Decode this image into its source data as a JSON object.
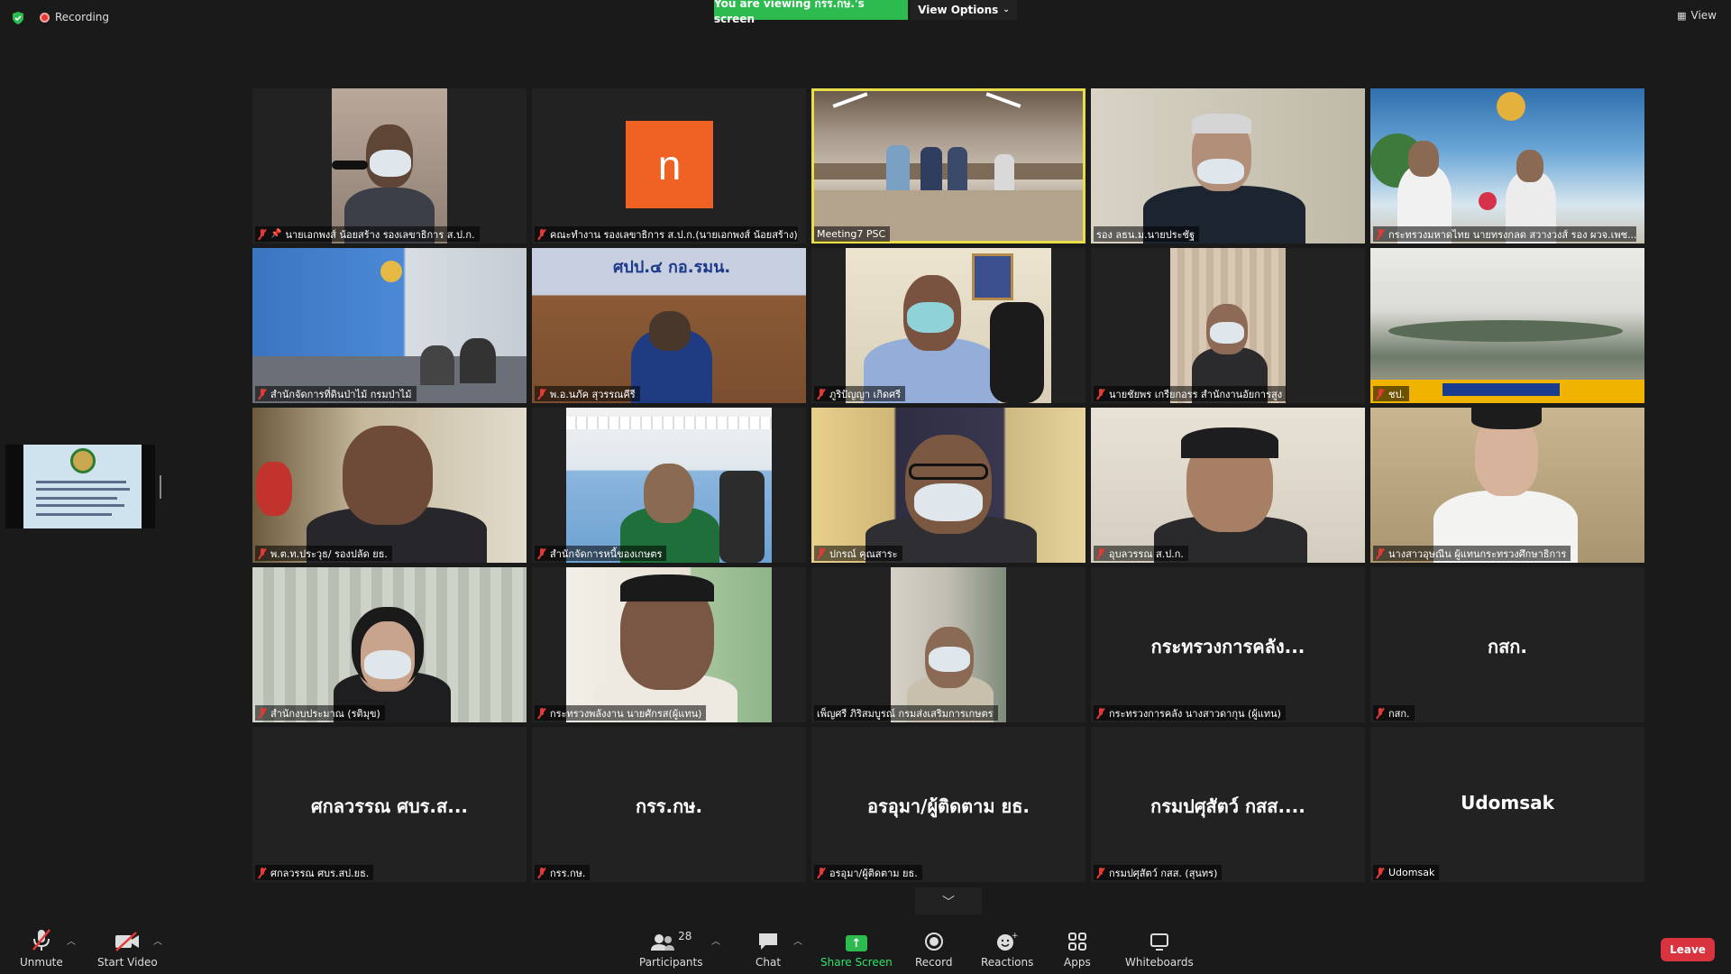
{
  "top_bar": {
    "recording_label": "Recording",
    "viewing_banner": "You are viewing กรร.กษ.'s screen",
    "view_options_label": "View Options",
    "view_label": "View"
  },
  "tiles": [
    {
      "name": "นายเอกพงส์ น้อยสร้าง รองเลขาธิการ ส.ป.ก.",
      "pinned": true
    },
    {
      "name": "คณะทำงาน รองเลขาธิการ ส.ป.ก.(นายเอกพงส์ น้อยสร้าง)",
      "avatar_letter": "n"
    },
    {
      "name": "Meeting7 PSC",
      "active": true
    },
    {
      "name": "รอง ลธน.ม.นายประชัฐ"
    },
    {
      "name": "กระทรวงมหาดไทย นายทรงกลด สวางวงส์ รอง ผวจ.เพช..."
    },
    {
      "name": "สำนักจัดการที่ดินป่าไม้ กรมป่าไม้"
    },
    {
      "name": "พ.อ.นภัค สุวรรณคีรี"
    },
    {
      "name": "ภูริปัญญา เกิดศรี"
    },
    {
      "name": "นายชัยพร เกรียกอรร สำนักงานอัยการสูง"
    },
    {
      "name": "ชป."
    },
    {
      "name": "พ.ต.ท.ประวุธ/ รองปลัด ยธ."
    },
    {
      "name": "สำนักจัดการหนี้ของเกษตร"
    },
    {
      "name": "ปกรณ์ คุณสาระ"
    },
    {
      "name": "อุบลวรรณ ส.ป.ก."
    },
    {
      "name": "นางสาวอุษณีน ผู้แทนกระทรวงศึกษาธิการ"
    },
    {
      "name": "สำนักงบประมาณ (รติมุข)"
    },
    {
      "name": "กระทรวงพลังงาน นายศักรส(ผู้แทน)"
    },
    {
      "name": "เพ็ญศรี ภิริสมบูรณ์ กรมส่งเสริมการเกษตร"
    },
    {
      "name": "กระทรวงการคลัง นางสาวดากุน (ผู้แทน)",
      "display_name": "กระทรวงการคลัง..."
    },
    {
      "name": "กสก.",
      "display_name": "กสก."
    },
    {
      "name": "ศกลวรรณ ศบร.สป.ยธ.",
      "display_name": "ศกลวรรณ ศบร.ส..."
    },
    {
      "name": "กรร.กษ.",
      "display_name": "กรร.กษ."
    },
    {
      "name": "อรอุมา/ผู้ติดตาม ยธ.",
      "display_name": "อรอุมา/ผู้ติดตาม ยธ."
    },
    {
      "name": "กรมปศุสัตว์ กสส. (สุนทร)",
      "display_name": "กรมปศุสัตว์ กสส...."
    },
    {
      "name": "Udomsak",
      "display_name": "Udomsak"
    }
  ],
  "toolbar": {
    "unmute": "Unmute",
    "start_video": "Start Video",
    "participants": "Participants",
    "participants_count": "28",
    "chat": "Chat",
    "share_screen": "Share Screen",
    "record": "Record",
    "reactions": "Reactions",
    "apps": "Apps",
    "whiteboards": "Whiteboards",
    "leave": "Leave"
  },
  "colors": {
    "accent_green": "#2dbb4f",
    "leave_red": "#d9333f",
    "active_speaker": "#e8de4a",
    "avatar_orange": "#ef6224"
  }
}
